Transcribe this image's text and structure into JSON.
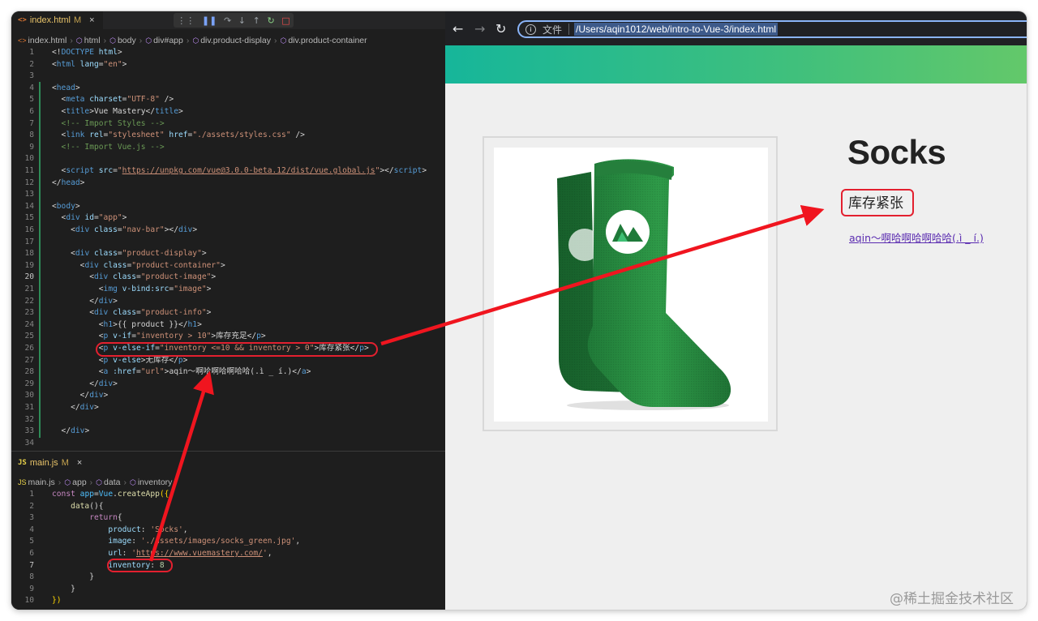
{
  "editor": {
    "tab1": {
      "name": "index.html",
      "modified": "M",
      "close": "×"
    },
    "debug_icons": [
      "⋮⋮",
      "❚❚",
      "↷",
      "↓",
      "↑",
      "↻",
      "□"
    ],
    "breadcrumb1": [
      "index.html",
      "html",
      "body",
      "div#app",
      "div.product-display",
      "div.product-container"
    ],
    "html_code": [
      {
        "n": "1",
        "p": [
          [
            "t-txt",
            "<!"
          ],
          [
            "t-tag",
            "DOCTYPE"
          ],
          [
            "t-txt",
            " "
          ],
          [
            "t-attr",
            "html"
          ],
          [
            "t-txt",
            ">"
          ]
        ]
      },
      {
        "n": "2",
        "p": [
          [
            "t-txt",
            "<"
          ],
          [
            "t-tag",
            "html"
          ],
          [
            "t-txt",
            " "
          ],
          [
            "t-attr",
            "lang"
          ],
          [
            "t-txt",
            "="
          ],
          [
            "t-str",
            "\"en\""
          ],
          [
            "t-txt",
            ">"
          ]
        ]
      },
      {
        "n": "3",
        "p": []
      },
      {
        "n": "4",
        "p": [
          [
            "t-txt",
            "<"
          ],
          [
            "t-tag",
            "head"
          ],
          [
            "t-txt",
            ">"
          ]
        ]
      },
      {
        "n": "5",
        "p": [
          [
            "t-txt",
            "  <"
          ],
          [
            "t-tag",
            "meta"
          ],
          [
            "t-txt",
            " "
          ],
          [
            "t-attr",
            "charset"
          ],
          [
            "t-txt",
            "="
          ],
          [
            "t-str",
            "\"UTF-8\""
          ],
          [
            "t-txt",
            " />"
          ]
        ]
      },
      {
        "n": "6",
        "p": [
          [
            "t-txt",
            "  <"
          ],
          [
            "t-tag",
            "title"
          ],
          [
            "t-txt",
            ">Vue Mastery</"
          ],
          [
            "t-tag",
            "title"
          ],
          [
            "t-txt",
            ">"
          ]
        ]
      },
      {
        "n": "7",
        "p": [
          [
            "t-com",
            "  <!-- Import Styles -->"
          ]
        ]
      },
      {
        "n": "8",
        "p": [
          [
            "t-txt",
            "  <"
          ],
          [
            "t-tag",
            "link"
          ],
          [
            "t-txt",
            " "
          ],
          [
            "t-attr",
            "rel"
          ],
          [
            "t-txt",
            "="
          ],
          [
            "t-str",
            "\"stylesheet\""
          ],
          [
            "t-txt",
            " "
          ],
          [
            "t-attr",
            "href"
          ],
          [
            "t-txt",
            "="
          ],
          [
            "t-str",
            "\"./assets/styles.css\""
          ],
          [
            "t-txt",
            " />"
          ]
        ]
      },
      {
        "n": "9",
        "p": [
          [
            "t-com",
            "  <!-- Import Vue.js -->"
          ]
        ]
      },
      {
        "n": "10",
        "p": []
      },
      {
        "n": "11",
        "p": [
          [
            "t-txt",
            "  <"
          ],
          [
            "t-tag",
            "script"
          ],
          [
            "t-txt",
            " "
          ],
          [
            "t-attr",
            "src"
          ],
          [
            "t-txt",
            "="
          ],
          [
            "t-str",
            "\""
          ],
          [
            "t-link",
            "https://unpkg.com/vue@3.0.0-beta.12/dist/vue.global.js"
          ],
          [
            "t-str",
            "\""
          ],
          [
            "t-txt",
            "></"
          ],
          [
            "t-tag",
            "script"
          ],
          [
            "t-txt",
            ">"
          ]
        ]
      },
      {
        "n": "12",
        "p": [
          [
            "t-txt",
            "</"
          ],
          [
            "t-tag",
            "head"
          ],
          [
            "t-txt",
            ">"
          ]
        ]
      },
      {
        "n": "13",
        "p": []
      },
      {
        "n": "14",
        "p": [
          [
            "t-txt",
            "<"
          ],
          [
            "t-tag",
            "body"
          ],
          [
            "t-txt",
            ">"
          ]
        ]
      },
      {
        "n": "15",
        "p": [
          [
            "t-txt",
            "  <"
          ],
          [
            "t-tag",
            "div"
          ],
          [
            "t-txt",
            " "
          ],
          [
            "t-attr",
            "id"
          ],
          [
            "t-txt",
            "="
          ],
          [
            "t-str",
            "\"app\""
          ],
          [
            "t-txt",
            ">"
          ]
        ]
      },
      {
        "n": "16",
        "p": [
          [
            "t-txt",
            "    <"
          ],
          [
            "t-tag",
            "div"
          ],
          [
            "t-txt",
            " "
          ],
          [
            "t-attr",
            "class"
          ],
          [
            "t-txt",
            "="
          ],
          [
            "t-str",
            "\"nav-bar\""
          ],
          [
            "t-txt",
            "></"
          ],
          [
            "t-tag",
            "div"
          ],
          [
            "t-txt",
            ">"
          ]
        ]
      },
      {
        "n": "17",
        "p": []
      },
      {
        "n": "18",
        "p": [
          [
            "t-txt",
            "    <"
          ],
          [
            "t-tag",
            "div"
          ],
          [
            "t-txt",
            " "
          ],
          [
            "t-attr",
            "class"
          ],
          [
            "t-txt",
            "="
          ],
          [
            "t-str",
            "\"product-display\""
          ],
          [
            "t-txt",
            ">"
          ]
        ]
      },
      {
        "n": "19",
        "p": [
          [
            "t-txt",
            "      <"
          ],
          [
            "t-tag",
            "div"
          ],
          [
            "t-txt",
            " "
          ],
          [
            "t-attr",
            "class"
          ],
          [
            "t-txt",
            "="
          ],
          [
            "t-str",
            "\"product-container\""
          ],
          [
            "t-txt",
            ">"
          ]
        ]
      },
      {
        "n": "20",
        "p": [
          [
            "t-txt",
            "        <"
          ],
          [
            "t-tag",
            "div"
          ],
          [
            "t-txt",
            " "
          ],
          [
            "t-attr",
            "class"
          ],
          [
            "t-txt",
            "="
          ],
          [
            "t-str",
            "\"product-image\""
          ],
          [
            "t-txt",
            ">"
          ]
        ]
      },
      {
        "n": "21",
        "p": [
          [
            "t-txt",
            "          <"
          ],
          [
            "t-tag",
            "img"
          ],
          [
            "t-txt",
            " "
          ],
          [
            "t-attr",
            "v-bind:src"
          ],
          [
            "t-txt",
            "="
          ],
          [
            "t-str",
            "\"image\""
          ],
          [
            "t-txt",
            ">"
          ]
        ]
      },
      {
        "n": "22",
        "p": [
          [
            "t-txt",
            "        </"
          ],
          [
            "t-tag",
            "div"
          ],
          [
            "t-txt",
            ">"
          ]
        ]
      },
      {
        "n": "23",
        "p": [
          [
            "t-txt",
            "        <"
          ],
          [
            "t-tag",
            "div"
          ],
          [
            "t-txt",
            " "
          ],
          [
            "t-attr",
            "class"
          ],
          [
            "t-txt",
            "="
          ],
          [
            "t-str",
            "\"product-info\""
          ],
          [
            "t-txt",
            ">"
          ]
        ]
      },
      {
        "n": "24",
        "p": [
          [
            "t-txt",
            "          <"
          ],
          [
            "t-tag",
            "h1"
          ],
          [
            "t-txt",
            ">{{ product }}</"
          ],
          [
            "t-tag",
            "h1"
          ],
          [
            "t-txt",
            ">"
          ]
        ]
      },
      {
        "n": "25",
        "p": [
          [
            "t-txt",
            "          <"
          ],
          [
            "t-tag",
            "p"
          ],
          [
            "t-txt",
            " "
          ],
          [
            "t-attr",
            "v-if"
          ],
          [
            "t-txt",
            "="
          ],
          [
            "t-str",
            "\"inventory > 10\""
          ],
          [
            "t-txt",
            ">库存充足</"
          ],
          [
            "t-tag",
            "p"
          ],
          [
            "t-txt",
            ">"
          ]
        ]
      },
      {
        "n": "26",
        "p": [
          [
            "t-txt",
            "          <"
          ],
          [
            "t-tag",
            "p"
          ],
          [
            "t-txt",
            " "
          ],
          [
            "t-attr",
            "v-else-if"
          ],
          [
            "t-txt",
            "="
          ],
          [
            "t-str",
            "\"inventory <=10 && inventory > 0\""
          ],
          [
            "t-txt",
            ">库存紧张</"
          ],
          [
            "t-tag",
            "p"
          ],
          [
            "t-txt",
            ">"
          ]
        ]
      },
      {
        "n": "27",
        "p": [
          [
            "t-txt",
            "          <"
          ],
          [
            "t-tag",
            "p"
          ],
          [
            "t-txt",
            " "
          ],
          [
            "t-attr",
            "v-else"
          ],
          [
            "t-txt",
            ">无库存</"
          ],
          [
            "t-tag",
            "p"
          ],
          [
            "t-txt",
            ">"
          ]
        ]
      },
      {
        "n": "28",
        "p": [
          [
            "t-txt",
            "          <"
          ],
          [
            "t-tag",
            "a"
          ],
          [
            "t-txt",
            " "
          ],
          [
            "t-attr",
            ":href"
          ],
          [
            "t-txt",
            "="
          ],
          [
            "t-str",
            "\"url\""
          ],
          [
            "t-txt",
            ">aqin～啊哈啊哈啊哈哈(.ì _ í.)</"
          ],
          [
            "t-tag",
            "a"
          ],
          [
            "t-txt",
            ">"
          ]
        ]
      },
      {
        "n": "29",
        "p": [
          [
            "t-txt",
            "        </"
          ],
          [
            "t-tag",
            "div"
          ],
          [
            "t-txt",
            ">"
          ]
        ]
      },
      {
        "n": "30",
        "p": [
          [
            "t-txt",
            "      </"
          ],
          [
            "t-tag",
            "div"
          ],
          [
            "t-txt",
            ">"
          ]
        ]
      },
      {
        "n": "31",
        "p": [
          [
            "t-txt",
            "    </"
          ],
          [
            "t-tag",
            "div"
          ],
          [
            "t-txt",
            ">"
          ]
        ]
      },
      {
        "n": "32",
        "p": []
      },
      {
        "n": "33",
        "p": [
          [
            "t-txt",
            "  </"
          ],
          [
            "t-tag",
            "div"
          ],
          [
            "t-txt",
            ">"
          ]
        ]
      },
      {
        "n": "34",
        "p": []
      }
    ],
    "tab2": {
      "icon": "JS",
      "name": "main.js",
      "modified": "M",
      "close": "×"
    },
    "breadcrumb2": [
      "main.js",
      "app",
      "data",
      "inventory"
    ],
    "js_code": [
      {
        "n": "1",
        "p": [
          [
            "t-kw",
            "const"
          ],
          [
            "t-txt",
            " "
          ],
          [
            "t-var",
            "app"
          ],
          [
            "t-txt",
            "="
          ],
          [
            "t-var",
            "Vue"
          ],
          [
            "t-txt",
            "."
          ],
          [
            "t-fn",
            "createApp"
          ],
          [
            "t-b1",
            "({"
          ]
        ]
      },
      {
        "n": "2",
        "p": [
          [
            "t-txt",
            "    "
          ],
          [
            "t-fn",
            "data"
          ],
          [
            "t-txt",
            "(){"
          ]
        ]
      },
      {
        "n": "3",
        "p": [
          [
            "t-txt",
            "        "
          ],
          [
            "t-kw",
            "return"
          ],
          [
            "t-txt",
            "{"
          ]
        ]
      },
      {
        "n": "4",
        "p": [
          [
            "t-txt",
            "            "
          ],
          [
            "t-prop",
            "product"
          ],
          [
            "t-txt",
            ": "
          ],
          [
            "t-str",
            "'Socks'"
          ],
          [
            "t-txt",
            ","
          ]
        ]
      },
      {
        "n": "5",
        "p": [
          [
            "t-txt",
            "            "
          ],
          [
            "t-prop",
            "image"
          ],
          [
            "t-txt",
            ": "
          ],
          [
            "t-str",
            "'./assets/images/socks_green.jpg'"
          ],
          [
            "t-txt",
            ","
          ]
        ]
      },
      {
        "n": "6",
        "p": [
          [
            "t-txt",
            "            "
          ],
          [
            "t-prop",
            "url"
          ],
          [
            "t-txt",
            ": "
          ],
          [
            "t-str",
            "'"
          ],
          [
            "t-link",
            "https://www.vuemastery.com/"
          ],
          [
            "t-str",
            "'"
          ],
          [
            "t-txt",
            ","
          ]
        ]
      },
      {
        "n": "7",
        "p": [
          [
            "t-txt",
            "            "
          ],
          [
            "t-prop",
            "inventory"
          ],
          [
            "t-txt",
            ": "
          ],
          [
            "t-num",
            "8"
          ]
        ]
      },
      {
        "n": "8",
        "p": [
          [
            "t-txt",
            "        }"
          ]
        ]
      },
      {
        "n": "9",
        "p": [
          [
            "t-txt",
            "    }"
          ]
        ]
      },
      {
        "n": "10",
        "p": [
          [
            "t-b1",
            "})"
          ]
        ]
      }
    ]
  },
  "browser": {
    "back_icon": "←",
    "forward_icon": "→",
    "reload_icon": "↻",
    "info_icon": "i",
    "site_label": "文件",
    "url": "/Users/aqin1012/web/intro-to-Vue-3/index.html",
    "product_title": "Socks",
    "stock_status": "库存紧张",
    "link_text": "aqin～啊哈啊哈啊哈哈(.ì _ í.)"
  },
  "colors": {
    "accent_red": "#e3202f",
    "nav_gradient_start": "#16b69a",
    "nav_gradient_end": "#63c86a",
    "sock_green": "#2e9a48"
  },
  "watermark": "@稀土掘金技术社区"
}
